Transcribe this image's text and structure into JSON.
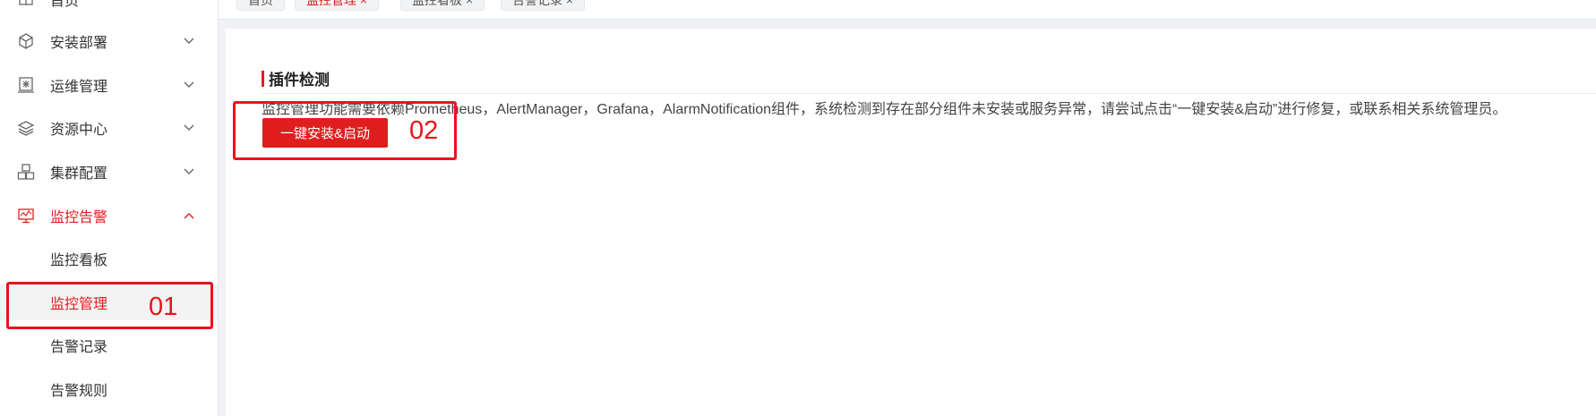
{
  "sidebar": {
    "items": [
      {
        "label": "首页",
        "icon": "home-icon"
      },
      {
        "label": "安装部署",
        "icon": "box-icon",
        "arrow": "chevron-down-icon"
      },
      {
        "label": "运维管理",
        "icon": "ops-icon",
        "arrow": "chevron-down-icon"
      },
      {
        "label": "资源中心",
        "icon": "layers-icon",
        "arrow": "chevron-down-icon"
      },
      {
        "label": "集群配置",
        "icon": "cluster-icon",
        "arrow": "chevron-down-icon"
      },
      {
        "label": "监控告警",
        "icon": "monitor-icon",
        "arrow": "chevron-up-icon"
      }
    ],
    "sub_items": [
      {
        "label": "监控看板"
      },
      {
        "label": "监控管理"
      },
      {
        "label": "告警记录"
      },
      {
        "label": "告警规则"
      }
    ]
  },
  "tabs": [
    {
      "label": "首页"
    },
    {
      "label": "监控管理 ×"
    },
    {
      "label": "监控看板 ×"
    },
    {
      "label": "告警记录 ×"
    }
  ],
  "content": {
    "section_title": "插件检测",
    "description": "监控管理功能需要依赖Prometheus，AlertManager，Grafana，AlarmNotification组件，系统检测到存在部分组件未安装或服务异常，请尝试点击“一键安装&启动”进行修复，或联系相关系统管理员。",
    "install_button": "一键安装&启动"
  },
  "annotations": {
    "label_1": "01",
    "label_2": "02"
  },
  "colors": {
    "accent": "#e01e1e",
    "annotation": "#e8141b"
  }
}
